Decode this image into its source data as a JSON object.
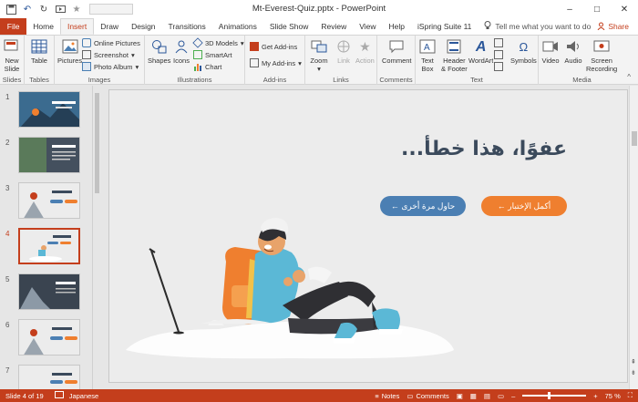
{
  "window": {
    "title": "Mt-Everest-Quiz.pptx - PowerPoint",
    "controls": [
      "–",
      "□",
      "✕"
    ]
  },
  "tabs": [
    "File",
    "Home",
    "Insert",
    "Draw",
    "Design",
    "Transitions",
    "Animations",
    "Slide Show",
    "Review",
    "View",
    "Help",
    "iSpring Suite 11"
  ],
  "active_tab": "Insert",
  "tell_me": "Tell me what you want to do",
  "share": "Share",
  "ribbon": {
    "slides": {
      "label": "Slides",
      "new_slide": "New",
      "new_slide2": "Slide"
    },
    "tables": {
      "label": "Tables",
      "table": "Table"
    },
    "images": {
      "label": "Images",
      "pictures": "Pictures",
      "online_pictures": "Online Pictures",
      "screenshot": "Screenshot",
      "photo_album": "Photo Album"
    },
    "illustrations": {
      "label": "Illustrations",
      "shapes": "Shapes",
      "icons": "Icons",
      "models_3d": "3D Models",
      "smartart": "SmartArt",
      "chart": "Chart"
    },
    "addins": {
      "label": "Add-ins",
      "get_addins": "Get Add-ins",
      "my_addins": "My Add-ins"
    },
    "links": {
      "label": "Links",
      "zoom": "Zoom",
      "link": "Link",
      "action": "Action"
    },
    "comments": {
      "label": "Comments",
      "comment": "Comment"
    },
    "text": {
      "label": "Text",
      "text_box": "Text",
      "text_box2": "Box",
      "header_footer": "Header",
      "header_footer2": "& Footer",
      "wordart": "WordArt",
      "symbols": "Symbols"
    },
    "media": {
      "label": "Media",
      "video": "Video",
      "audio": "Audio",
      "screen_recording": "Screen",
      "screen_recording2": "Recording"
    }
  },
  "thumbnails": [
    {
      "num": "1",
      "selected": false
    },
    {
      "num": "2",
      "selected": false
    },
    {
      "num": "3",
      "selected": false
    },
    {
      "num": "4",
      "selected": true
    },
    {
      "num": "5",
      "selected": false
    },
    {
      "num": "6",
      "selected": false
    },
    {
      "num": "7",
      "selected": false
    }
  ],
  "slide": {
    "headline": "عفوًا، هذا خطأ...",
    "continue_button": "أكمل الإختبار ←",
    "retry_button": "حاول مرة أخرى ←"
  },
  "status": {
    "slide_info": "Slide 4 of 19",
    "language": "Japanese",
    "notes": "Notes",
    "comments": "Comments",
    "zoom": "75 %"
  },
  "colors": {
    "accent": "#c43e1c",
    "orange_button": "#ef7f2f",
    "blue_button": "#4b7fb3",
    "headline": "#3b4a5c"
  }
}
